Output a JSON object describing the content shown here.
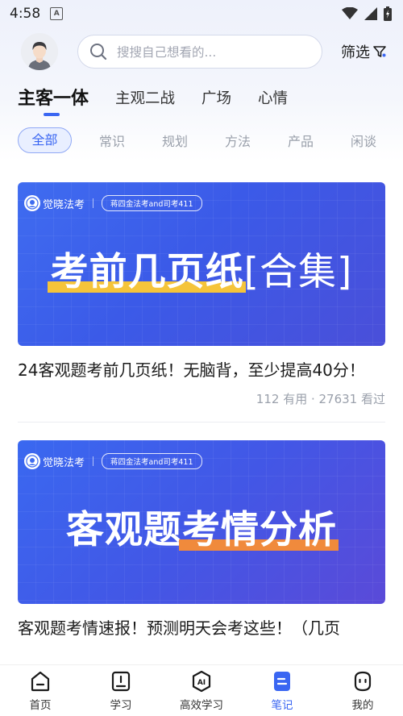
{
  "status_bar": {
    "time": "4:58",
    "app_icon_letter": "A"
  },
  "header": {
    "search_placeholder": "搜搜自己想看的...",
    "filter_label": "筛选"
  },
  "main_tabs": [
    "主客一体",
    "主观二战",
    "广场",
    "心情"
  ],
  "sub_tabs": [
    "全部",
    "常识",
    "规划",
    "方法",
    "产品",
    "闲谈"
  ],
  "cards": [
    {
      "brand": "觉晓法考",
      "tag": "蒋四金法考and司考411",
      "banner_highlight": "考前几页纸",
      "banner_bracket": "[合集]",
      "title": "24客观题考前几页纸！无脑背，至少提高40分！",
      "meta": "112 有用 · 27631 看过"
    },
    {
      "brand": "觉晓法考",
      "tag": "蒋四金法考and司考411",
      "banner_plain": "客观题",
      "banner_highlight": "考情分析",
      "title": "客观题考情速报！预测明天会考这些！（几页"
    }
  ],
  "bottom_nav": [
    {
      "label": "首页",
      "icon": "home-icon"
    },
    {
      "label": "学习",
      "icon": "study-icon"
    },
    {
      "label": "高效学习",
      "icon": "ai-icon"
    },
    {
      "label": "笔记",
      "icon": "notes-icon",
      "active": true
    },
    {
      "label": "我的",
      "icon": "profile-icon"
    }
  ],
  "colors": {
    "accent": "#3a66f2",
    "banner_blue": "#3f6cf0",
    "highlight_yellow": "#f5c43a",
    "highlight_orange": "#f08a3c"
  }
}
